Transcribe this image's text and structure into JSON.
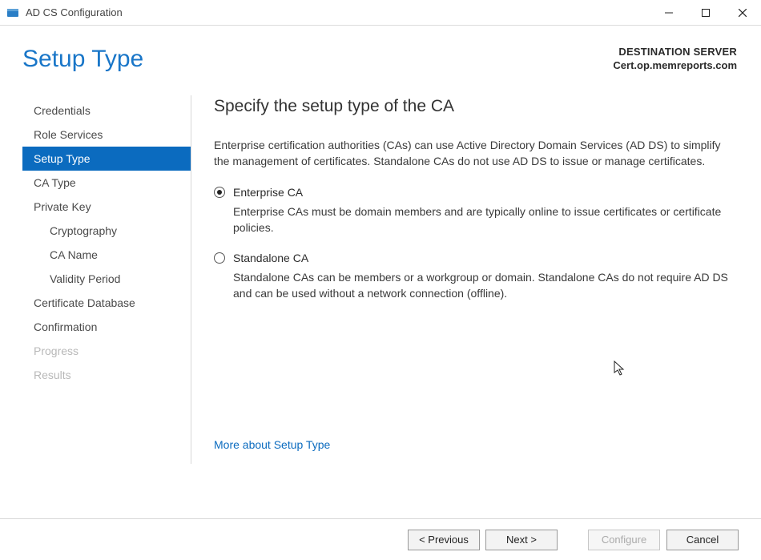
{
  "window": {
    "title": "AD CS Configuration"
  },
  "header": {
    "page_title": "Setup Type",
    "destination_label": "DESTINATION SERVER",
    "destination_server": "Cert.op.memreports.com"
  },
  "sidebar": {
    "items": [
      {
        "label": "Credentials",
        "indent": false,
        "selected": false,
        "disabled": false
      },
      {
        "label": "Role Services",
        "indent": false,
        "selected": false,
        "disabled": false
      },
      {
        "label": "Setup Type",
        "indent": false,
        "selected": true,
        "disabled": false
      },
      {
        "label": "CA Type",
        "indent": false,
        "selected": false,
        "disabled": false
      },
      {
        "label": "Private Key",
        "indent": false,
        "selected": false,
        "disabled": false
      },
      {
        "label": "Cryptography",
        "indent": true,
        "selected": false,
        "disabled": false
      },
      {
        "label": "CA Name",
        "indent": true,
        "selected": false,
        "disabled": false
      },
      {
        "label": "Validity Period",
        "indent": true,
        "selected": false,
        "disabled": false
      },
      {
        "label": "Certificate Database",
        "indent": false,
        "selected": false,
        "disabled": false
      },
      {
        "label": "Confirmation",
        "indent": false,
        "selected": false,
        "disabled": false
      },
      {
        "label": "Progress",
        "indent": false,
        "selected": false,
        "disabled": true
      },
      {
        "label": "Results",
        "indent": false,
        "selected": false,
        "disabled": true
      }
    ]
  },
  "main": {
    "heading": "Specify the setup type of the CA",
    "description": "Enterprise certification authorities (CAs) can use Active Directory Domain Services (AD DS) to simplify the management of certificates. Standalone CAs do not use AD DS to issue or manage certificates.",
    "options": [
      {
        "label": "Enterprise CA",
        "selected": true,
        "description": "Enterprise CAs must be domain members and are typically online to issue certificates or certificate policies."
      },
      {
        "label": "Standalone CA",
        "selected": false,
        "description": "Standalone CAs can be members or a workgroup or domain. Standalone CAs do not require AD DS and can be used without a network connection (offline)."
      }
    ],
    "more_link": "More about Setup Type"
  },
  "footer": {
    "previous": "< Previous",
    "next": "Next >",
    "configure": "Configure",
    "cancel": "Cancel"
  }
}
